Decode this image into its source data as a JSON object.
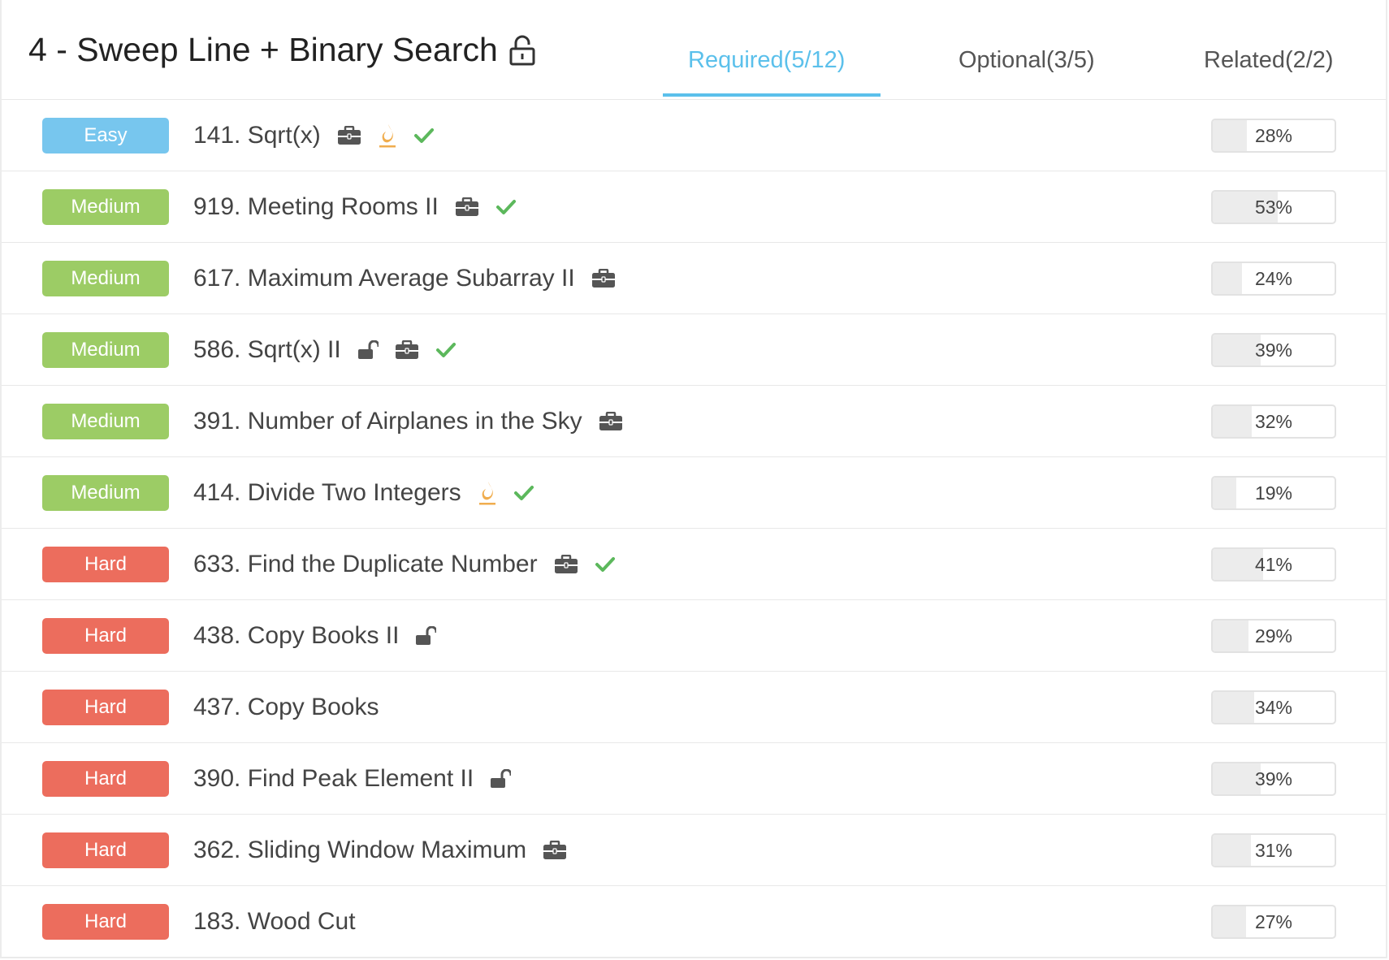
{
  "section": {
    "title": "4 - Sweep Line + Binary Search",
    "lock_icon": "lock-open-icon"
  },
  "tabs": [
    {
      "label": "Required(5/12)",
      "active": true
    },
    {
      "label": "Optional(3/5)",
      "active": false
    },
    {
      "label": "Related(2/2)",
      "active": false
    }
  ],
  "colors": {
    "accent": "#5bc0eb",
    "easy": "#77c6ee",
    "medium": "#9ccc65",
    "hard": "#ec6d5d",
    "check": "#5cb85c",
    "flame": "#f0ad4e"
  },
  "problems": [
    {
      "difficulty": "Easy",
      "title": "141. Sqrt(x)",
      "icons": [
        "briefcase-icon",
        "flame-icon",
        "check-icon"
      ],
      "acceptance": "28%"
    },
    {
      "difficulty": "Medium",
      "title": "919. Meeting Rooms II",
      "icons": [
        "briefcase-icon",
        "check-icon"
      ],
      "acceptance": "53%"
    },
    {
      "difficulty": "Medium",
      "title": "617. Maximum Average Subarray II",
      "icons": [
        "briefcase-icon"
      ],
      "acceptance": "24%"
    },
    {
      "difficulty": "Medium",
      "title": "586. Sqrt(x) II",
      "icons": [
        "lock-open-icon",
        "briefcase-icon",
        "check-icon"
      ],
      "acceptance": "39%"
    },
    {
      "difficulty": "Medium",
      "title": "391. Number of Airplanes in the Sky",
      "icons": [
        "briefcase-icon"
      ],
      "acceptance": "32%"
    },
    {
      "difficulty": "Medium",
      "title": "414. Divide Two Integers",
      "icons": [
        "flame-icon",
        "check-icon"
      ],
      "acceptance": "19%"
    },
    {
      "difficulty": "Hard",
      "title": "633. Find the Duplicate Number",
      "icons": [
        "briefcase-icon",
        "check-icon"
      ],
      "acceptance": "41%"
    },
    {
      "difficulty": "Hard",
      "title": "438. Copy Books II",
      "icons": [
        "lock-open-icon"
      ],
      "acceptance": "29%"
    },
    {
      "difficulty": "Hard",
      "title": "437. Copy Books",
      "icons": [],
      "acceptance": "34%"
    },
    {
      "difficulty": "Hard",
      "title": "390. Find Peak Element II",
      "icons": [
        "lock-open-icon"
      ],
      "acceptance": "39%"
    },
    {
      "difficulty": "Hard",
      "title": "362. Sliding Window Maximum",
      "icons": [
        "briefcase-icon"
      ],
      "acceptance": "31%"
    },
    {
      "difficulty": "Hard",
      "title": "183. Wood Cut",
      "icons": [],
      "acceptance": "27%"
    }
  ]
}
